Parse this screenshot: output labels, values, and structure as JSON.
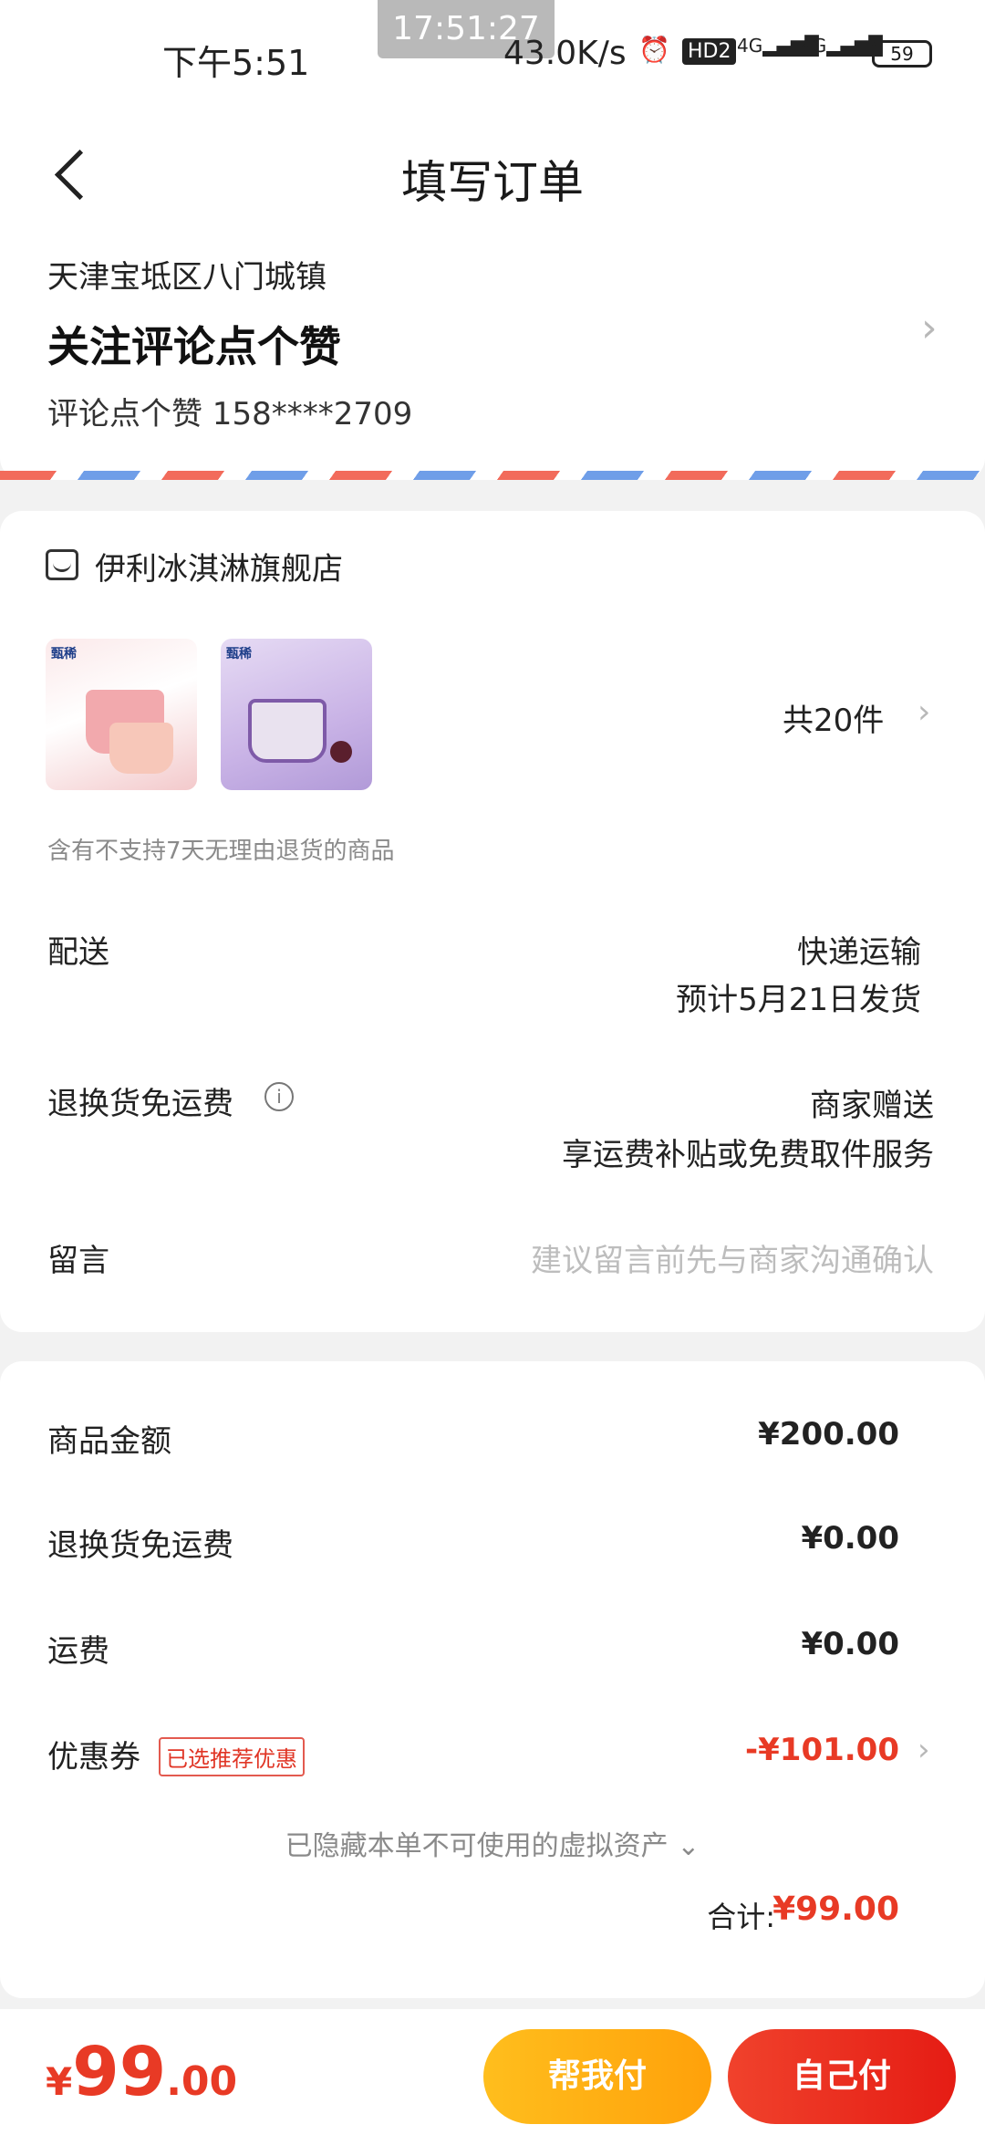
{
  "status_bar": {
    "time": "下午5:51",
    "overlay_clock": "17:51:27",
    "net_speed": "43.0K/s",
    "alarm_icon": "alarm-icon",
    "hd_badge": "HD2",
    "signal1": "4G",
    "signal2": "4G",
    "battery": "59"
  },
  "header": {
    "title": "填写订单",
    "back_icon": "back-arrow-icon"
  },
  "address": {
    "region": "天津宝坻区八门城镇",
    "recipient_name": "关注评论点个赞",
    "contact": "评论点个赞  158****2709"
  },
  "shop": {
    "name": "伊利冰淇淋旗舰店",
    "thumb1_brand": "甄稀",
    "thumb2_brand": "甄稀",
    "item_count": "共20件",
    "return_note": "含有不支持7天无理由退货的商品"
  },
  "delivery": {
    "label": "配送",
    "method": "快递运输",
    "estimate": "预计5月21日发货"
  },
  "return_shipping": {
    "label": "退换货免运费",
    "value": "商家赠送",
    "desc": "享运费补贴或免费取件服务"
  },
  "message": {
    "label": "留言",
    "placeholder": "建议留言前先与商家沟通确认"
  },
  "price_details": {
    "goods_label": "商品金额",
    "goods_amount": "¥200.00",
    "return_fee_label": "退换货免运费",
    "return_fee_amount": "¥0.00",
    "shipping_label": "运费",
    "shipping_amount": "¥0.00",
    "coupon_label": "优惠券",
    "coupon_tag": "已选推荐优惠",
    "coupon_amount": "-¥101.00",
    "hidden_assets": "已隐藏本单不可使用的虚拟资产 ⌄",
    "total_label": "合计:",
    "total_amount": "¥99.00"
  },
  "bottom_bar": {
    "currency": "¥",
    "price_int": "99",
    "price_dec": ".00",
    "help_pay": "帮我付",
    "self_pay": "自己付"
  },
  "colors": {
    "accent_red": "#e83a25",
    "accent_yellow": "#ffb413"
  }
}
